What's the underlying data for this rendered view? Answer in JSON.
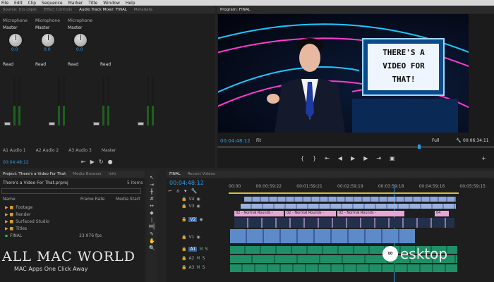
{
  "menu": [
    "File",
    "Edit",
    "Clip",
    "Sequence",
    "Marker",
    "Title",
    "Window",
    "Help"
  ],
  "top_left_tabs": [
    "Source: (no clips)",
    "Effect Controls",
    "Audio Track Mixer: FINAL",
    "Metadata"
  ],
  "mixer": {
    "channels": [
      {
        "input": "Microphone",
        "mode": "Master",
        "value": "0.0",
        "read": "Read",
        "name": "Audio 1",
        "id": "A1"
      },
      {
        "input": "Microphone",
        "mode": "Master",
        "value": "0.0",
        "read": "Read",
        "name": "Audio 2",
        "id": "A2"
      },
      {
        "input": "Microphone",
        "mode": "Master",
        "value": "0.0",
        "read": "Read",
        "name": "Audio 3",
        "id": "A3"
      },
      {
        "input": "",
        "mode": "",
        "value": "",
        "read": "Read",
        "name": "Master",
        "id": ""
      }
    ],
    "timecode": "00:04:48:12"
  },
  "program": {
    "title": "Program: FINAL",
    "timecode": "00:04:48:12",
    "fit": "Fit",
    "quality": "Full",
    "duration": "00:06:34:11",
    "board_text": [
      "THERE'S A",
      "VIDEO FOR",
      "THAT!"
    ]
  },
  "project": {
    "tabs": [
      "Project: There's a Video For That",
      "Media Browser",
      "Info"
    ],
    "file": "There's a Video For That.prproj",
    "items_count": "5 Items",
    "columns": [
      "Name",
      "Frame Rate",
      "Media Start"
    ],
    "rows": [
      {
        "name": "Footage",
        "rate": ""
      },
      {
        "name": "Render",
        "rate": ""
      },
      {
        "name": "Surfaced Studio",
        "rate": ""
      },
      {
        "name": "Titles",
        "rate": ""
      },
      {
        "name": "FINAL",
        "rate": "23.976 fps"
      }
    ]
  },
  "timeline": {
    "tabs": [
      "FINAL",
      "Recent Videos"
    ],
    "timecode": "00:04:48:12",
    "ruler": [
      "00:00",
      "00:00:59:22",
      "00:01:59:21",
      "00:02:59:19",
      "00:03:59:18",
      "00:04:59:16",
      "00:05:59:15"
    ],
    "video_tracks": [
      "V4",
      "V3",
      "V2",
      "V1"
    ],
    "audio_tracks": [
      "A1",
      "A2",
      "A3"
    ],
    "clip_label": "02 - Normal Rounds -",
    "end_clip_label": "04"
  },
  "watermarks": {
    "left_line1": "ALL MAC WORLD",
    "left_line2": "MAC Apps One Click Away",
    "right": "esktop"
  }
}
